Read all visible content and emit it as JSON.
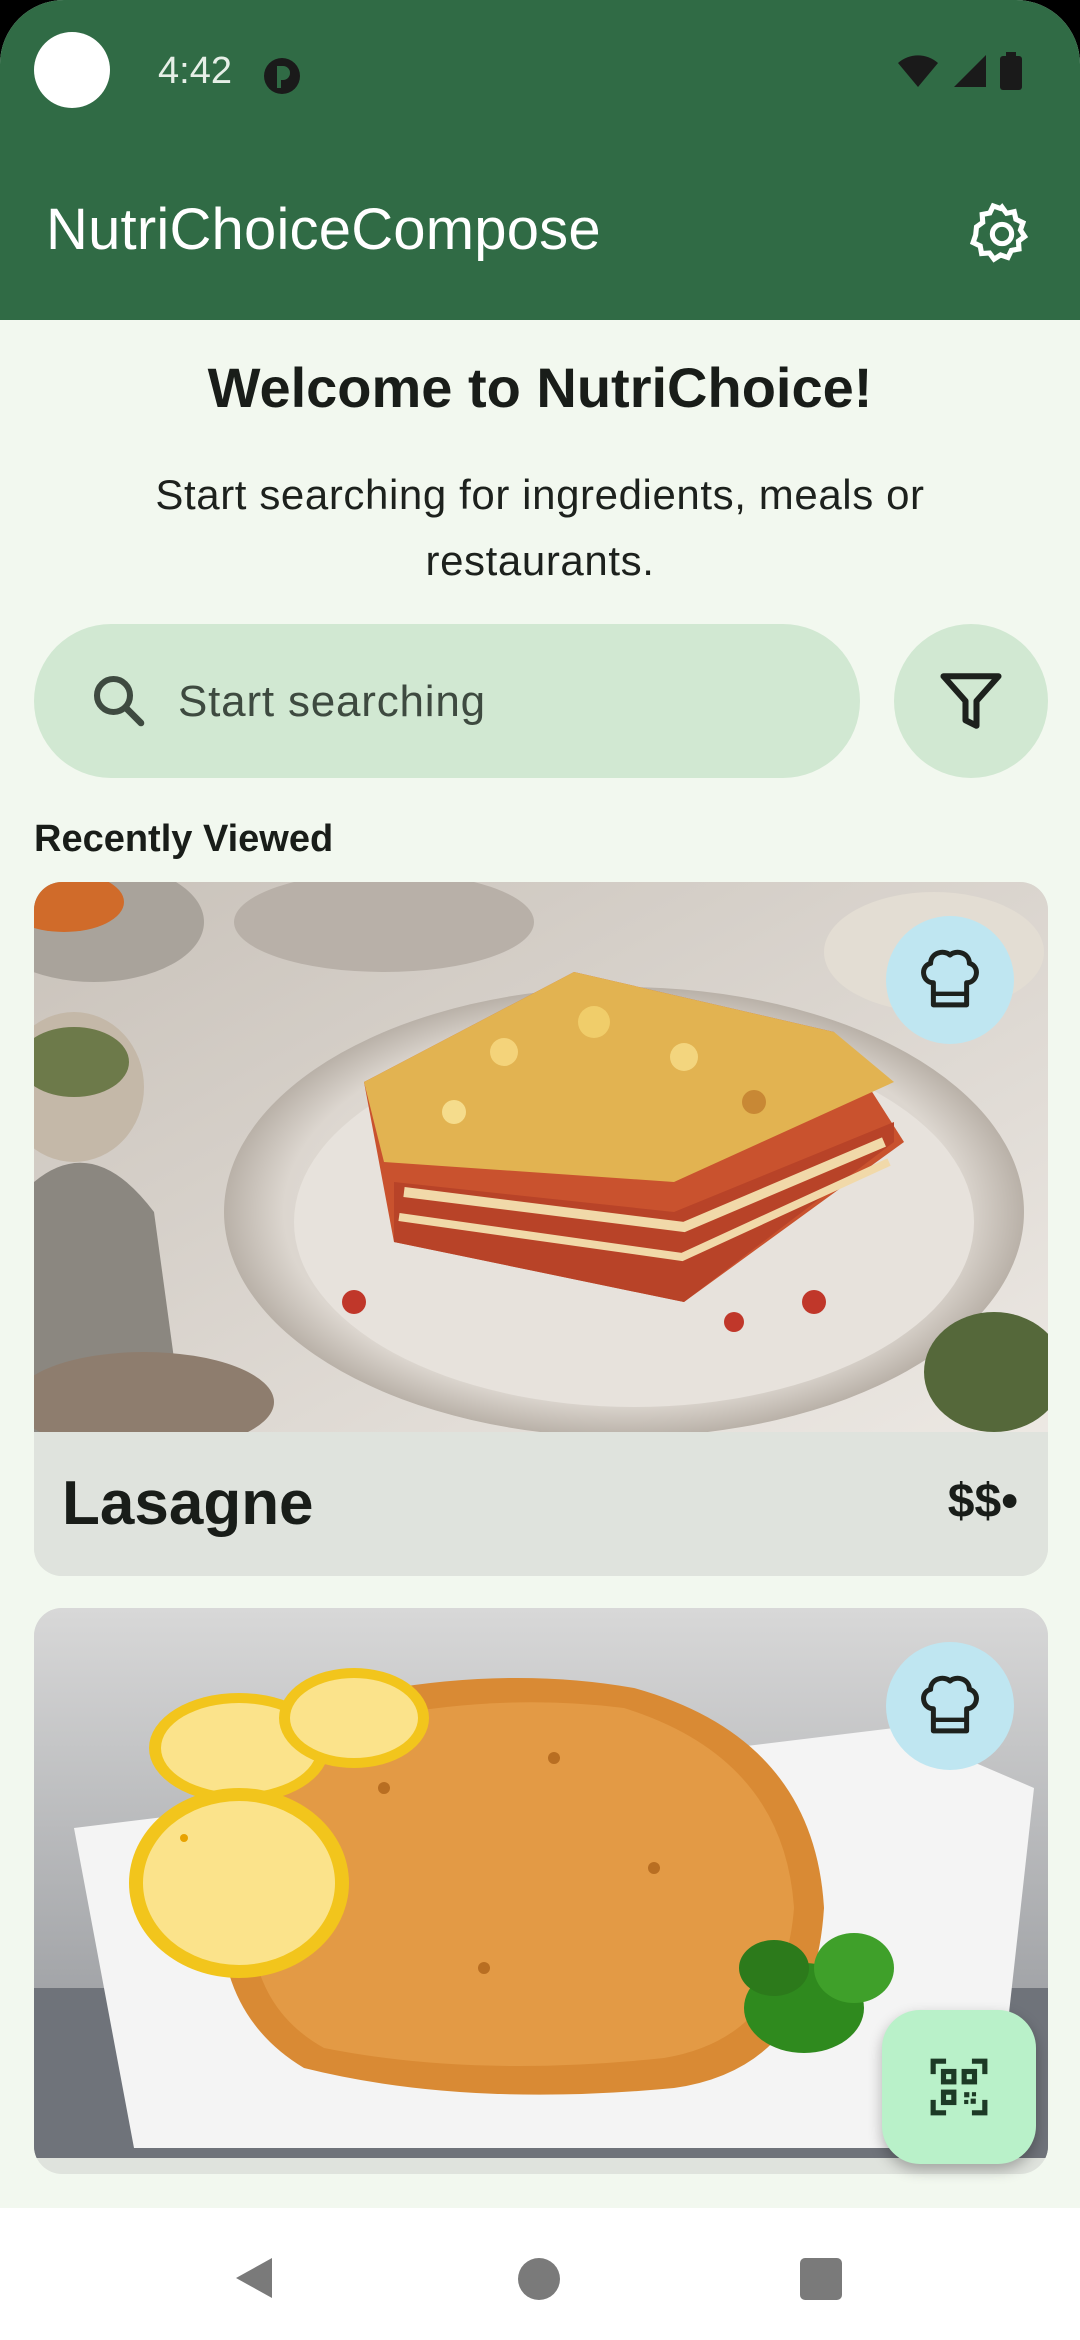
{
  "status_bar": {
    "time": "4:42"
  },
  "app_bar": {
    "title": "NutriChoiceCompose"
  },
  "welcome": {
    "title": "Welcome to NutriChoice!",
    "subtitle": "Start searching for ingredients, meals or restaurants."
  },
  "search": {
    "placeholder": "Start searching",
    "value": ""
  },
  "recently_viewed": {
    "label": "Recently Viewed",
    "items": [
      {
        "name": "Lasagne",
        "price": "$$•",
        "badge_icon": "chef-hat-icon"
      },
      {
        "name": "",
        "price": "",
        "badge_icon": "chef-hat-icon"
      }
    ]
  },
  "colors": {
    "primary": "#306b45",
    "background": "#f2f8ef",
    "search_container": "#d1e8d2",
    "card_footer": "#dfe3dd",
    "badge": "#bfe6f1",
    "fab": "#b9f1c9"
  }
}
